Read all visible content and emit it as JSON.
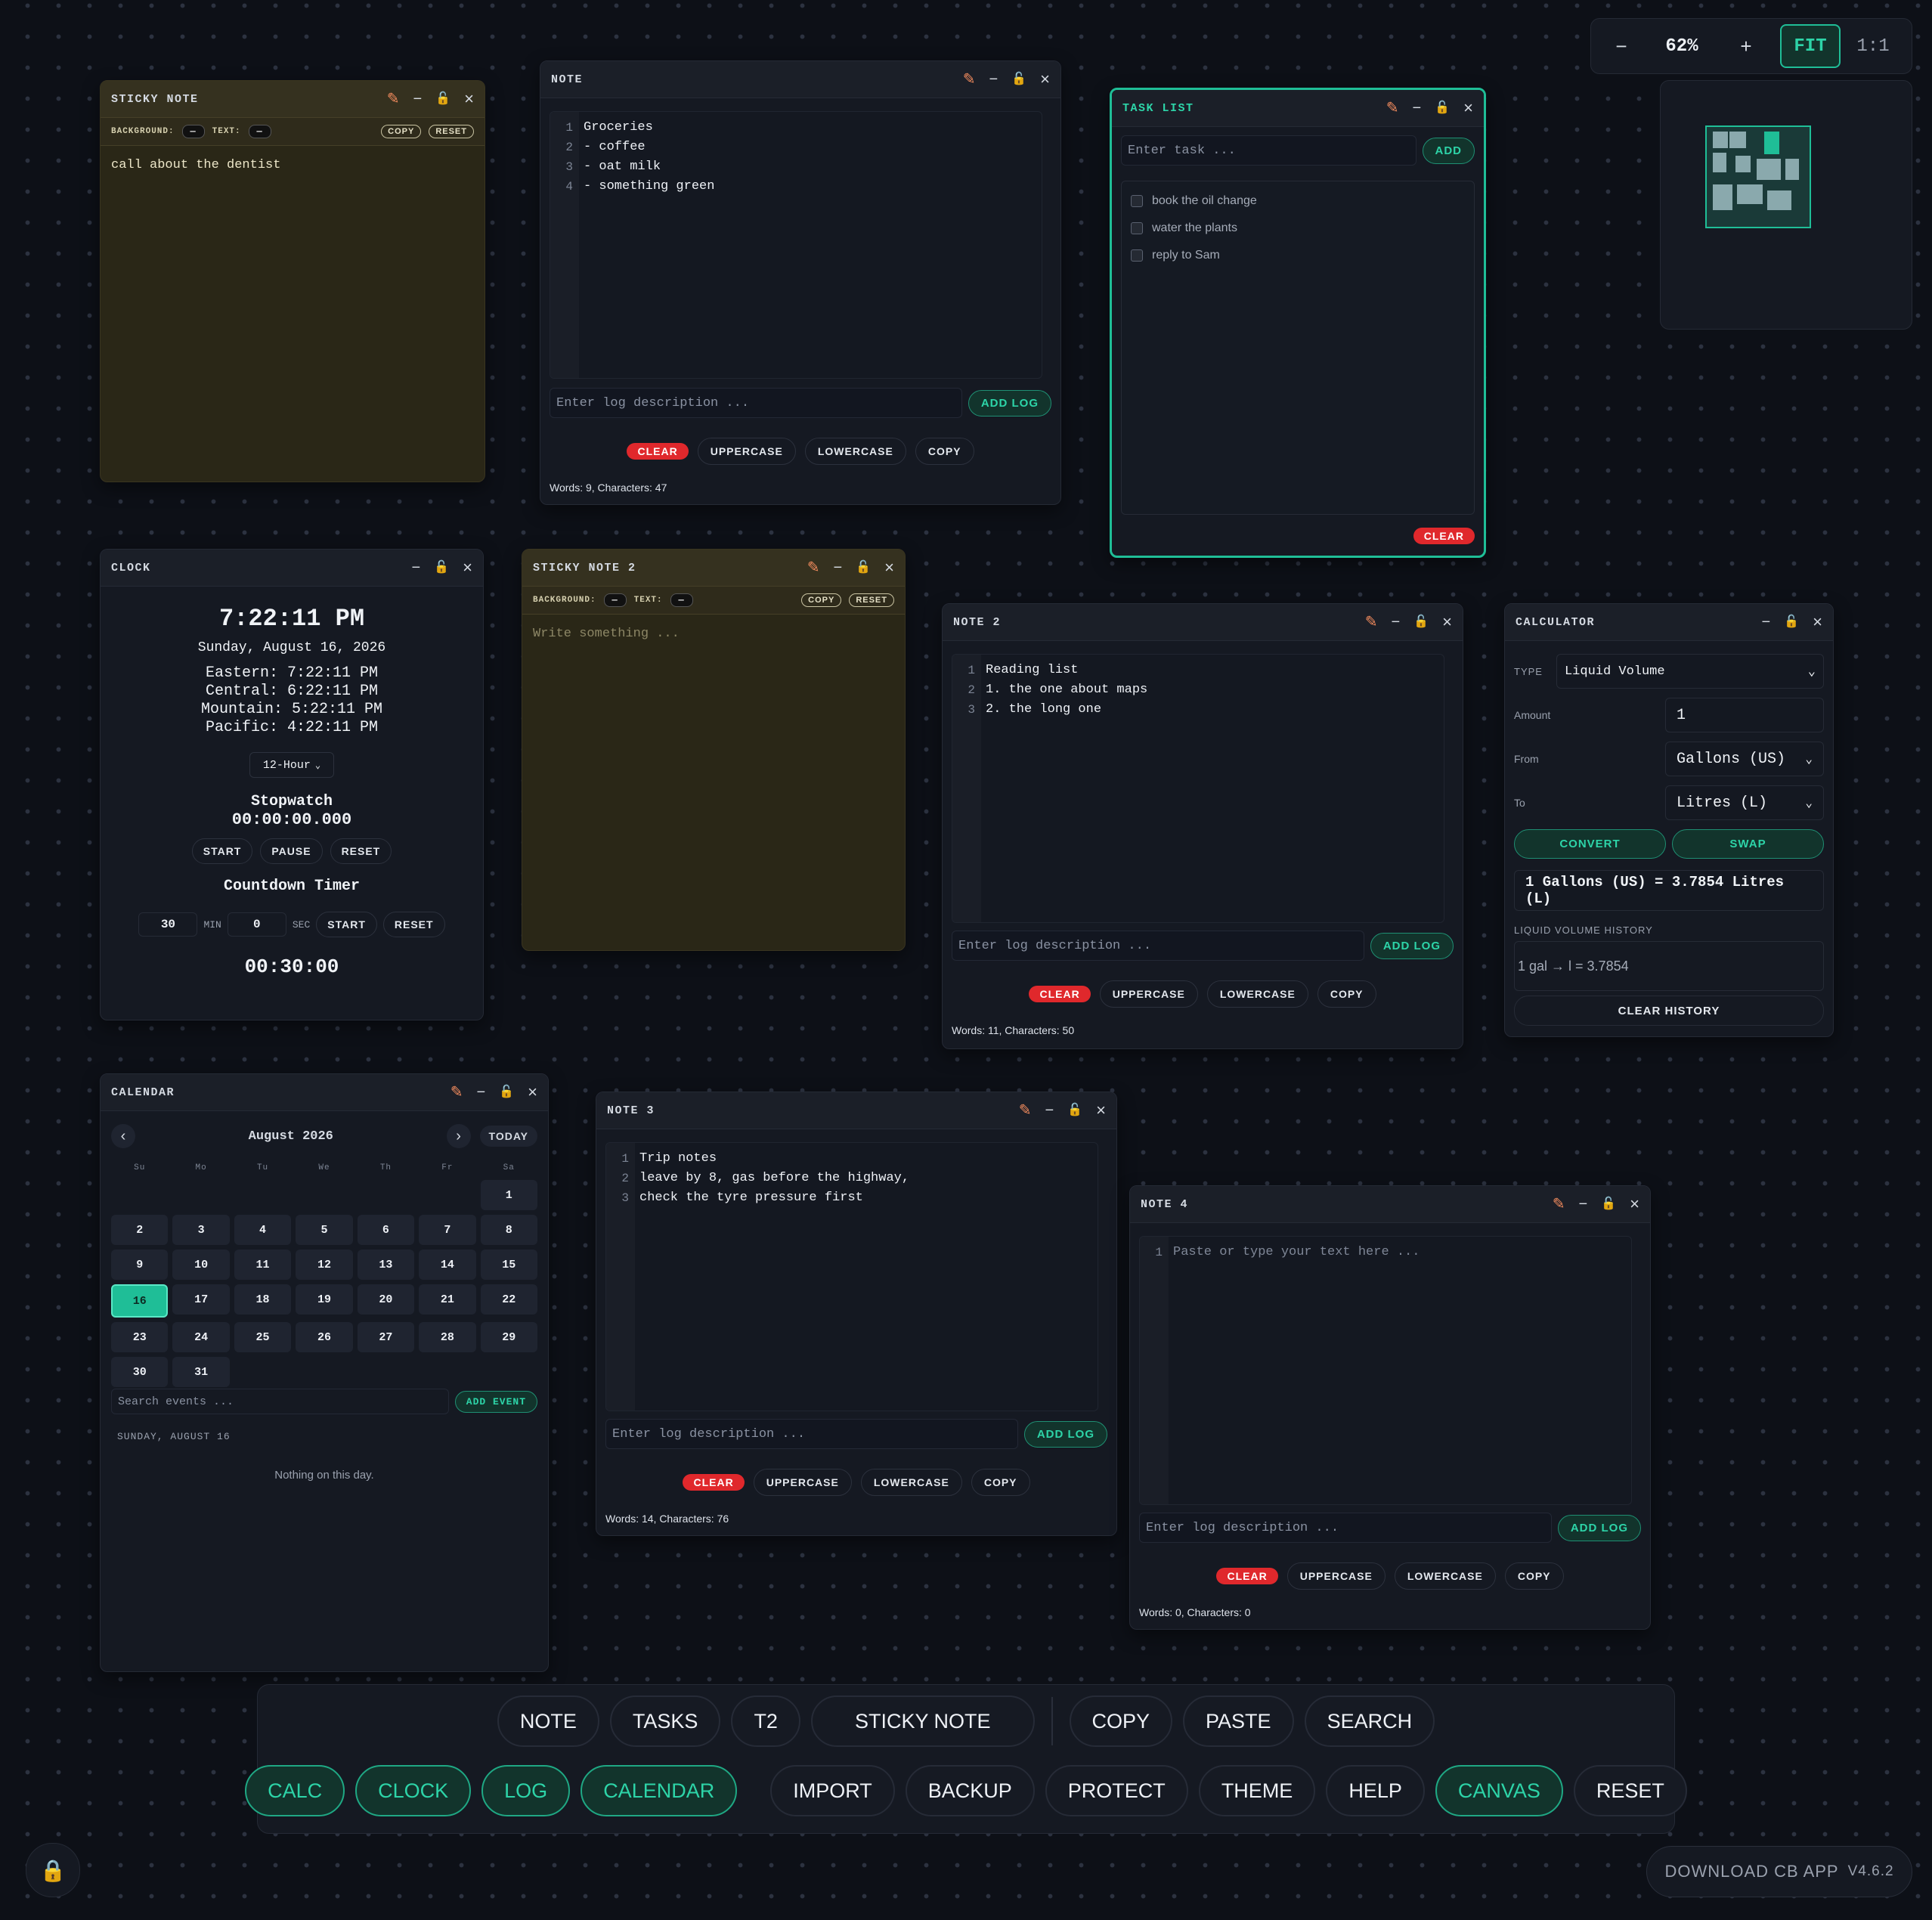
{
  "zoom": {
    "minus": "−",
    "level": "62%",
    "plus": "+",
    "fit": "FIT",
    "one": "1:1"
  },
  "sticky1": {
    "title": "STICKY NOTE",
    "bg_label": "BACKGROUND:",
    "text_label": "TEXT:",
    "copy": "COPY",
    "reset": "RESET",
    "content": "call about the dentist"
  },
  "note1": {
    "title": "NOTE",
    "gutter": "1\n2\n3\n4",
    "text": "Groceries\n- coffee\n- oat milk\n- something green",
    "log_placeholder": "Enter log description ...",
    "add_log": "ADD LOG",
    "clear": "CLEAR",
    "upper": "UPPERCASE",
    "lower": "LOWERCASE",
    "copy": "COPY",
    "counts": "Words: 9, Characters: 47"
  },
  "tasklist": {
    "title": "TASK LIST",
    "placeholder": "Enter task ...",
    "add": "ADD",
    "items": [
      "book the oil change",
      "water the plants",
      "reply to Sam"
    ],
    "clear": "CLEAR"
  },
  "clock": {
    "title": "CLOCK",
    "time": "7:22:11 PM",
    "date": "Sunday, August 16, 2026",
    "zones": [
      "Eastern: 7:22:11 PM",
      "Central: 6:22:11 PM",
      "Mountain: 5:22:11 PM",
      "Pacific: 4:22:11 PM"
    ],
    "format": "12-Hour",
    "stopwatch_label": "Stopwatch",
    "stopwatch_value": "00:00:00.000",
    "start": "START",
    "pause": "PAUSE",
    "reset": "RESET",
    "countdown_label": "Countdown Timer",
    "min_value": "30",
    "min_label": "MIN",
    "sec_value": "0",
    "sec_label": "SEC",
    "countdown_value": "00:30:00"
  },
  "sticky2": {
    "title": "STICKY NOTE 2",
    "bg_label": "BACKGROUND:",
    "text_label": "TEXT:",
    "copy": "COPY",
    "reset": "RESET",
    "placeholder": "Write something ..."
  },
  "note2": {
    "title": "NOTE 2",
    "gutter": "1\n2\n3",
    "text": "Reading list\n1. the one about maps\n2. the long one",
    "log_placeholder": "Enter log description ...",
    "add_log": "ADD LOG",
    "clear": "CLEAR",
    "upper": "UPPERCASE",
    "lower": "LOWERCASE",
    "copy": "COPY",
    "counts": "Words: 11, Characters: 50"
  },
  "calc": {
    "title": "CALCULATOR",
    "type_label": "TYPE",
    "type_value": "Liquid Volume",
    "amount_label": "Amount",
    "amount_value": "1",
    "from_label": "From",
    "from_value": "Gallons (US)",
    "to_label": "To",
    "to_value": "Litres (L)",
    "convert": "CONVERT",
    "swap": "SWAP",
    "result": "1 Gallons (US) = 3.7854 Litres (L)",
    "history_label": "LIQUID VOLUME HISTORY",
    "history_item": "1 gal → l = 3.7854",
    "clear_history": "CLEAR HISTORY"
  },
  "calendar": {
    "title": "CALENDAR",
    "prev": "‹",
    "month": "August 2026",
    "next": "›",
    "today": "TODAY",
    "dow": [
      "Su",
      "Mo",
      "Tu",
      "We",
      "Th",
      "Fr",
      "Sa"
    ],
    "first_weekday": 6,
    "days": 31,
    "selected": 16,
    "search_placeholder": "Search events ...",
    "add_event": "ADD EVENT",
    "selected_label": "SUNDAY, AUGUST 16",
    "empty": "Nothing on this day."
  },
  "note3": {
    "title": "NOTE 3",
    "gutter": "1\n2\n3",
    "text": "Trip notes\nleave by 8, gas before the highway,\ncheck the tyre pressure first",
    "log_placeholder": "Enter log description ...",
    "add_log": "ADD LOG",
    "clear": "CLEAR",
    "upper": "UPPERCASE",
    "lower": "LOWERCASE",
    "copy": "COPY",
    "counts": "Words: 14, Characters: 76"
  },
  "note4": {
    "title": "NOTE 4",
    "gutter": "1",
    "placeholder": "Paste or type your text here ...",
    "log_placeholder": "Enter log description ...",
    "add_log": "ADD LOG",
    "clear": "CLEAR",
    "upper": "UPPERCASE",
    "lower": "LOWERCASE",
    "copy": "COPY",
    "counts": "Words: 0, Characters: 0"
  },
  "toolbar": {
    "row1a": [
      "NOTE",
      "TASKS",
      "T2",
      "STICKY NOTE"
    ],
    "row1b": [
      "COPY",
      "PASTE",
      "SEARCH"
    ],
    "row2a": [
      "CALC",
      "CLOCK",
      "LOG",
      "CALENDAR"
    ],
    "row2b": [
      "IMPORT",
      "BACKUP",
      "PROTECT",
      "THEME",
      "HELP",
      "CANVAS",
      "RESET"
    ]
  },
  "download": {
    "label": "DOWNLOAD CB APP",
    "version": "V4.6.2"
  },
  "colors": {
    "accent": "#1fbe97",
    "danger": "#e0282c",
    "sticky_bg": "#2a2717",
    "bg": "#0d1017",
    "edit_icon": "#f08a5d",
    "lock_icon": "#f0a040"
  },
  "icons": [
    "edit-icon",
    "minimize-icon",
    "lock-icon",
    "close-icon",
    "chevron-down-icon",
    "padlock-icon"
  ]
}
